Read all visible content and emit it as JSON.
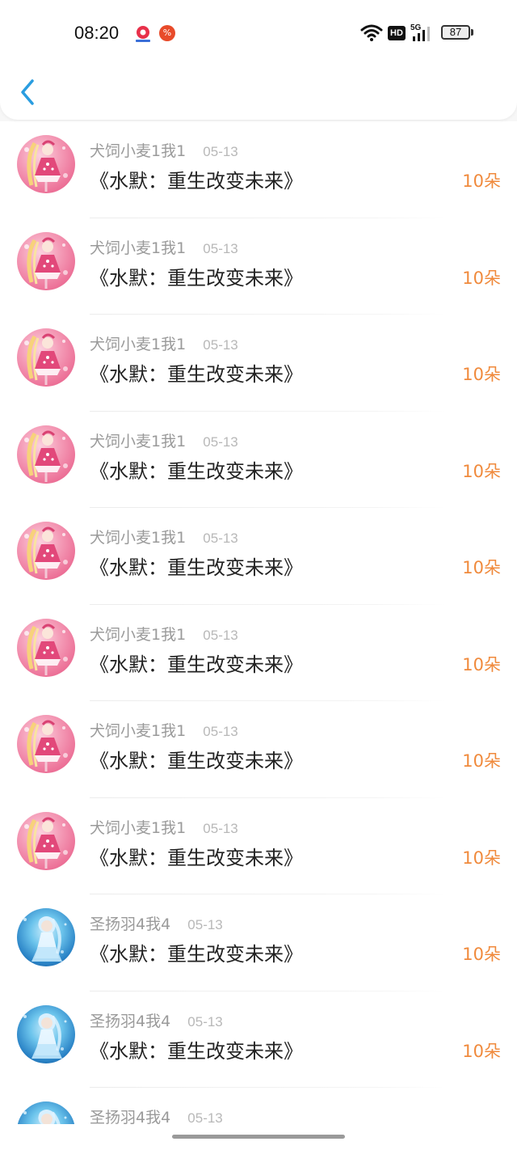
{
  "status_bar": {
    "time": "08:20",
    "app_badge": "%",
    "network_hd": "HD",
    "network_gen": "5G",
    "battery": "87"
  },
  "list": {
    "rows": [
      {
        "username": "犬饲小麦1我1",
        "date": "05-13",
        "title": "《水默：重生改变未来》",
        "amount": "10朵",
        "avatar": "pink"
      },
      {
        "username": "犬饲小麦1我1",
        "date": "05-13",
        "title": "《水默：重生改变未来》",
        "amount": "10朵",
        "avatar": "pink"
      },
      {
        "username": "犬饲小麦1我1",
        "date": "05-13",
        "title": "《水默：重生改变未来》",
        "amount": "10朵",
        "avatar": "pink"
      },
      {
        "username": "犬饲小麦1我1",
        "date": "05-13",
        "title": "《水默：重生改变未来》",
        "amount": "10朵",
        "avatar": "pink"
      },
      {
        "username": "犬饲小麦1我1",
        "date": "05-13",
        "title": "《水默：重生改变未来》",
        "amount": "10朵",
        "avatar": "pink"
      },
      {
        "username": "犬饲小麦1我1",
        "date": "05-13",
        "title": "《水默：重生改变未来》",
        "amount": "10朵",
        "avatar": "pink"
      },
      {
        "username": "犬饲小麦1我1",
        "date": "05-13",
        "title": "《水默：重生改变未来》",
        "amount": "10朵",
        "avatar": "pink"
      },
      {
        "username": "犬饲小麦1我1",
        "date": "05-13",
        "title": "《水默：重生改变未来》",
        "amount": "10朵",
        "avatar": "pink"
      },
      {
        "username": "圣扬羽4我4",
        "date": "05-13",
        "title": "《水默：重生改变未来》",
        "amount": "10朵",
        "avatar": "blue"
      },
      {
        "username": "圣扬羽4我4",
        "date": "05-13",
        "title": "《水默：重生改变未来》",
        "amount": "10朵",
        "avatar": "blue"
      },
      {
        "username": "圣扬羽4我4",
        "date": "05-13",
        "title": "",
        "amount": "",
        "avatar": "blue"
      }
    ]
  },
  "colors": {
    "accent_back": "#2a9de0",
    "amount": "#f08a3c",
    "username": "#9a9a9a",
    "date": "#b8b8b8",
    "title": "#222222"
  },
  "icons": {
    "back": "back-chevron-icon",
    "wifi": "wifi-icon",
    "signal": "signal-icon",
    "battery": "battery-icon",
    "avatar_pink": "pink-anime-girl-avatar",
    "avatar_blue": "blue-anime-girl-avatar"
  }
}
